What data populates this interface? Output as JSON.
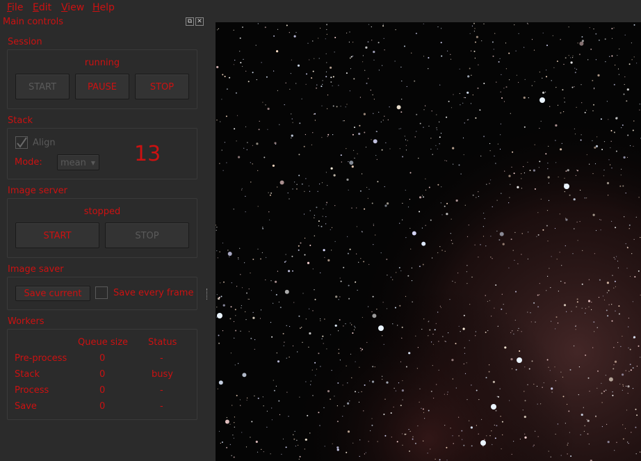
{
  "menu": {
    "items": [
      {
        "mnemonic": "F",
        "rest": "ile"
      },
      {
        "mnemonic": "E",
        "rest": "dit"
      },
      {
        "mnemonic": "V",
        "rest": "iew"
      },
      {
        "mnemonic": "H",
        "rest": "elp"
      }
    ]
  },
  "dock": {
    "title": "Main controls",
    "float_icon": "float-icon",
    "close_icon": "close-icon"
  },
  "session": {
    "label": "Session",
    "status": "running",
    "start": "START",
    "pause": "PAUSE",
    "stop": "STOP"
  },
  "stack": {
    "label": "Stack",
    "align_label": "Align",
    "align_checked": true,
    "mode_label": "Mode:",
    "mode_value": "mean",
    "count": "13"
  },
  "image_server": {
    "label": "Image server",
    "status": "stopped",
    "start": "START",
    "stop": "STOP"
  },
  "image_saver": {
    "label": "Image saver",
    "save_current": "Save current",
    "save_every_frame": "Save every frame",
    "save_every_frame_checked": false
  },
  "workers": {
    "label": "Workers",
    "headers": [
      "Queue size",
      "Status"
    ],
    "rows": [
      {
        "name": "Pre-process",
        "queue": "0",
        "status": "-"
      },
      {
        "name": "Stack",
        "queue": "0",
        "status": "busy"
      },
      {
        "name": "Process",
        "queue": "0",
        "status": "-"
      },
      {
        "name": "Save",
        "queue": "0",
        "status": "-"
      }
    ]
  },
  "colors": {
    "accent": "#cc1111",
    "background": "#2b2b2b",
    "disabled": "#5a5a5a"
  }
}
